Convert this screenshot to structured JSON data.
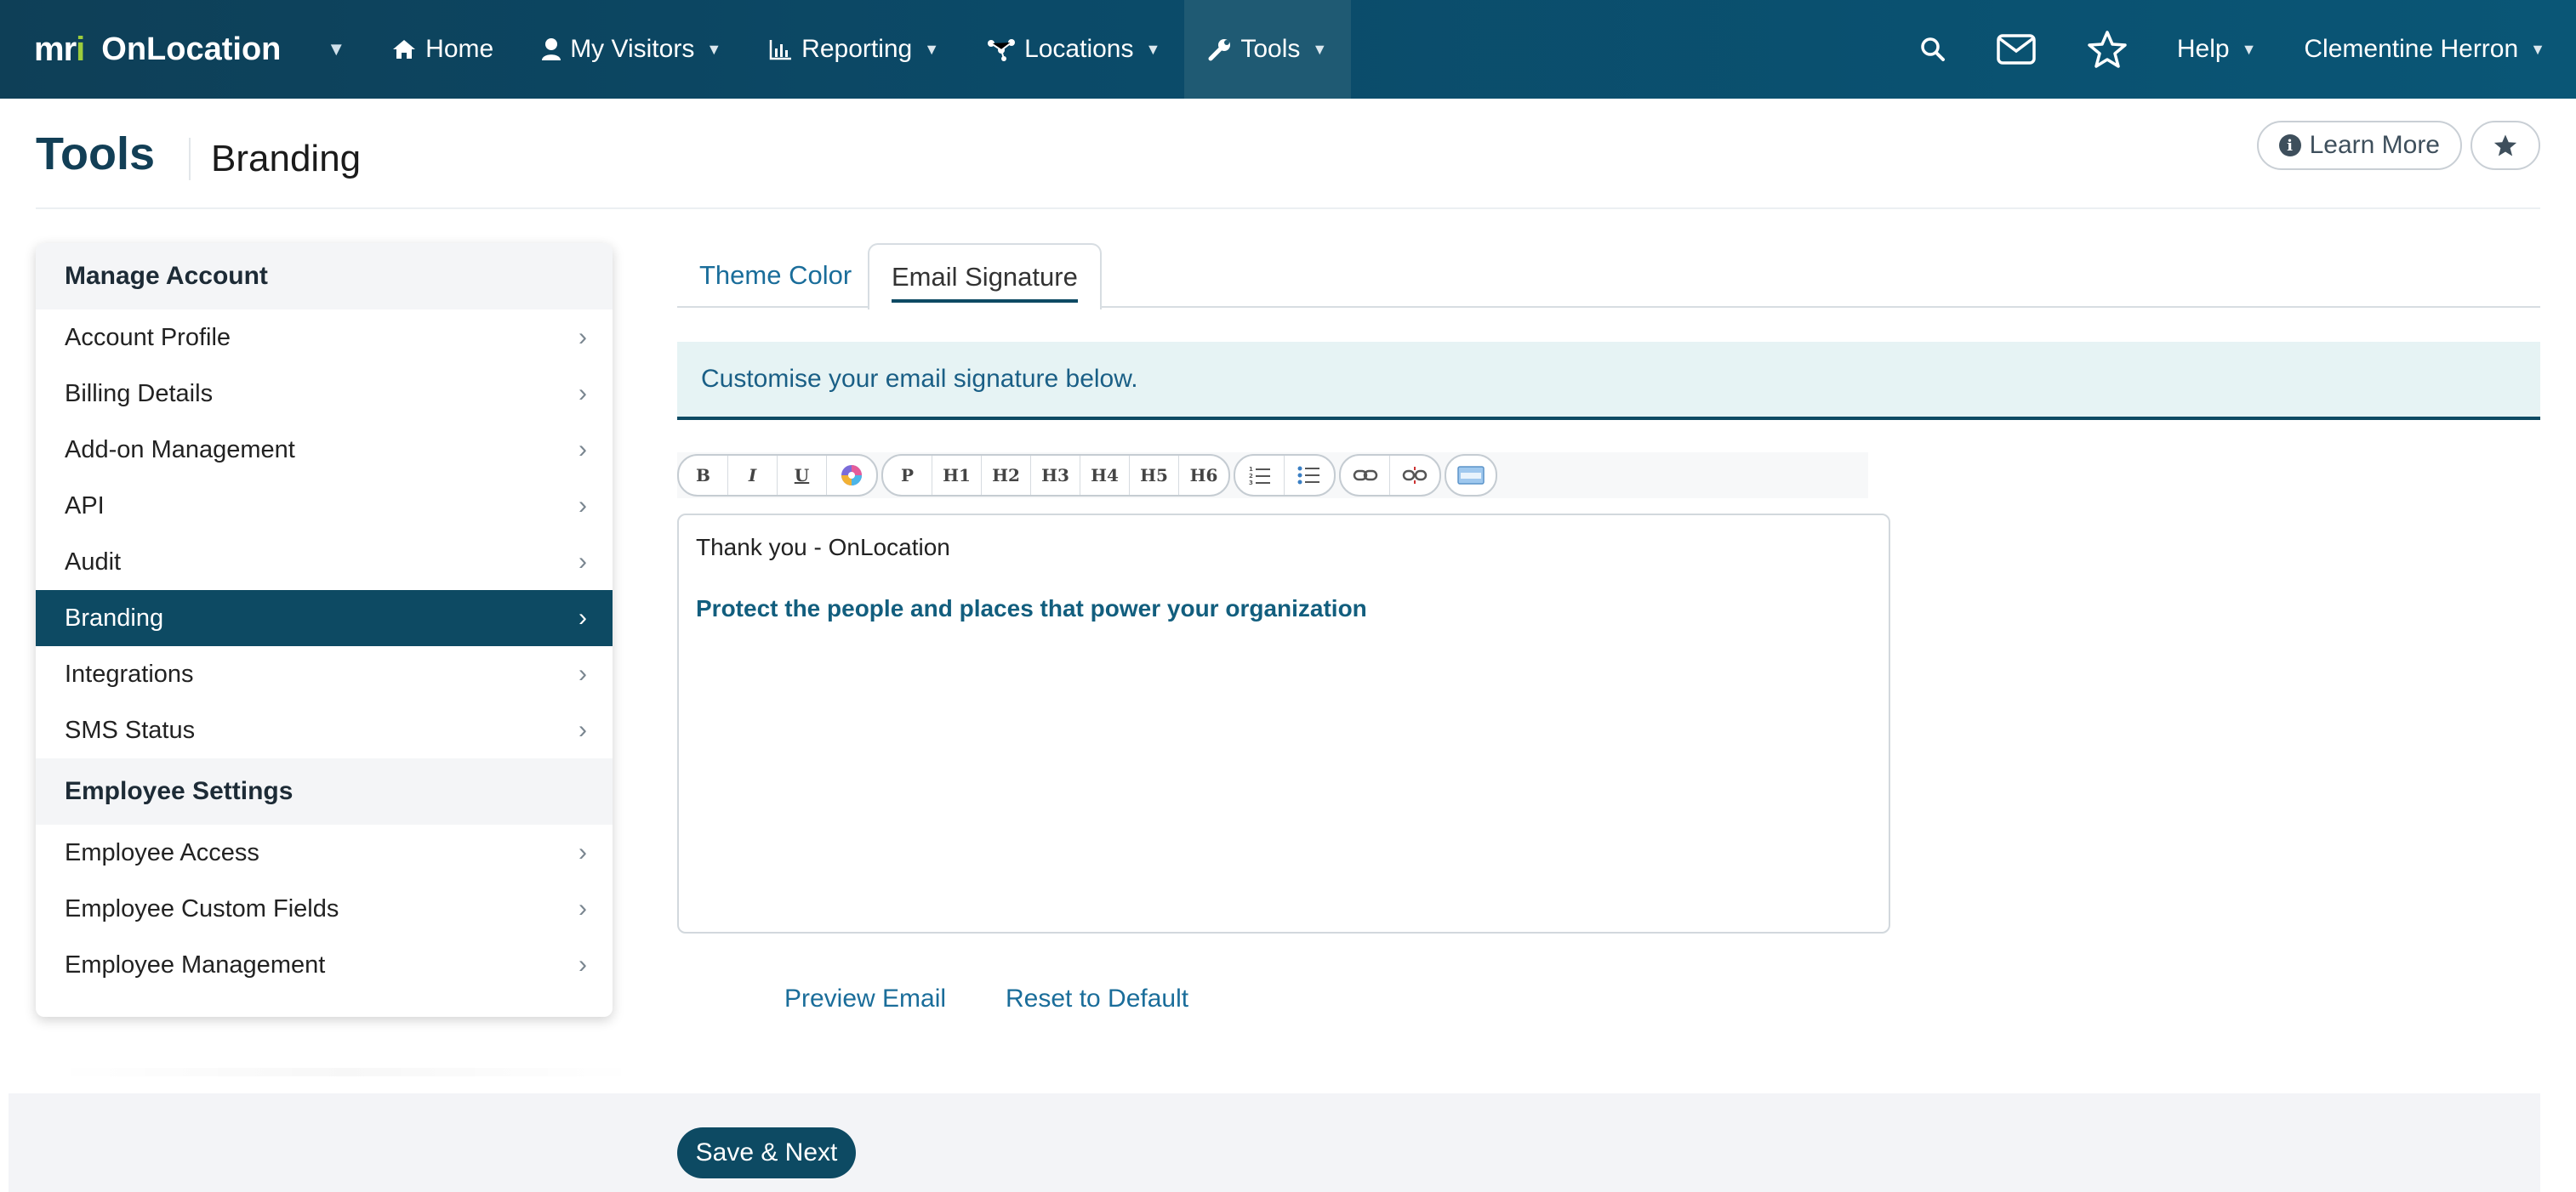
{
  "nav": {
    "brand_mark": "mri",
    "brand_name": "OnLocation",
    "items": [
      {
        "label": "Home",
        "icon": "home-icon"
      },
      {
        "label": "My Visitors",
        "icon": "user-icon"
      },
      {
        "label": "Reporting",
        "icon": "bar-chart-icon"
      },
      {
        "label": "Locations",
        "icon": "network-icon"
      },
      {
        "label": "Tools",
        "icon": "wrench-icon"
      }
    ],
    "help": "Help",
    "user": "Clementine Herron"
  },
  "header": {
    "title": "Tools",
    "subtitle": "Branding",
    "learn_more": "Learn More"
  },
  "sidebar": {
    "sections": [
      {
        "title": "Manage Account",
        "items": [
          "Account Profile",
          "Billing Details",
          "Add-on Management",
          "API",
          "Audit",
          "Branding",
          "Integrations",
          "SMS Status"
        ]
      },
      {
        "title": "Employee Settings",
        "items": [
          "Employee Access",
          "Employee Custom Fields",
          "Employee Management"
        ]
      }
    ],
    "active": "Branding"
  },
  "tabs": {
    "theme": "Theme Color",
    "email": "Email Signature"
  },
  "banner": "Customise your email signature below.",
  "toolbar": {
    "groups": [
      [
        "B",
        "I",
        "U",
        "color"
      ],
      [
        "P",
        "H1",
        "H2",
        "H3",
        "H4",
        "H5",
        "H6"
      ],
      [
        "ol",
        "ul"
      ],
      [
        "link",
        "unlink"
      ],
      [
        "html"
      ]
    ]
  },
  "editor": {
    "line1": "Thank you - OnLocation",
    "line2": "Protect the people and places that power your organization"
  },
  "links": {
    "preview": "Preview Email",
    "reset": "Reset to Default"
  },
  "footer": {
    "save": "Save & Next"
  },
  "colors": {
    "nav_bg": "#0b4a68",
    "accent": "#0d4a63",
    "link": "#1a6d9a",
    "brand_i": "#9ccc3c"
  }
}
